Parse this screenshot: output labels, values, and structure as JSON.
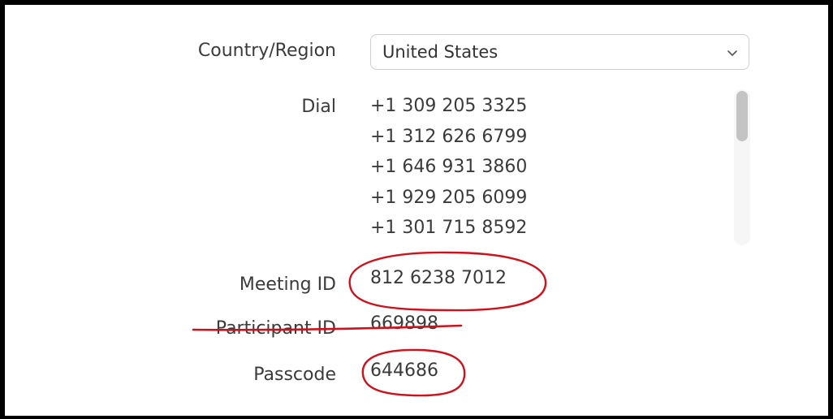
{
  "fields": {
    "country_label": "Country/Region",
    "country_value": "United States",
    "dial_label": "Dial",
    "meeting_id_label": "Meeting ID",
    "meeting_id_value": "812 6238 7012",
    "participant_id_label": "Participant ID",
    "participant_id_value": "669898",
    "passcode_label": "Passcode",
    "passcode_value": "644686"
  },
  "dial_numbers": [
    "+1 309 205 3325",
    "+1 312 626 6799",
    "+1 646 931 3860",
    "+1 929 205 6099",
    "+1 301 715 8592"
  ],
  "icons": {
    "dropdown": "chevron-down-icon"
  },
  "colors": {
    "annotation": "#d0101b",
    "border": "#000000",
    "text": "#3b3b3b"
  }
}
